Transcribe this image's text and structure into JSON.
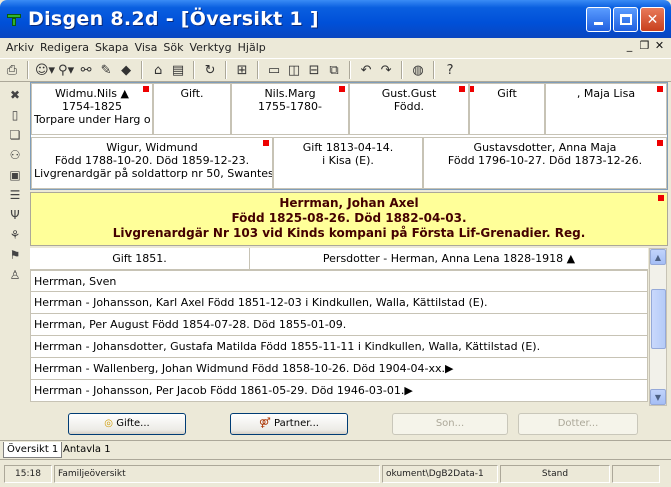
{
  "window": {
    "title": "Disgen 8.2d - [Översikt 1 ]"
  },
  "menu": [
    "Arkiv",
    "Redigera",
    "Skapa",
    "Visa",
    "Sök",
    "Verktyg",
    "Hjälp"
  ],
  "grandparents": [
    {
      "line1": "Widmu.Nils ▲",
      "line2": "1754-1825",
      "line3": "Torpare under Harg o"
    },
    {
      "line1": "Gift.",
      "line2": "",
      "line3": ""
    },
    {
      "line1": "Nils.Marg",
      "line2": "1755-1780-",
      "line3": ""
    },
    {
      "line1": "Gust.Gust",
      "line2": "Född.",
      "line3": ""
    },
    {
      "line1": "Gift",
      "line2": "",
      "line3": ""
    },
    {
      "line1": ", Maja Lisa",
      "line2": "",
      "line3": ""
    }
  ],
  "parents": {
    "father": {
      "line1": "Wigur, Widmund",
      "line2": "Född 1788-10-20. Död 1859-12-23.",
      "line3": "Livgrenardgär på soldattorp nr 50, Swantes"
    },
    "marriage": {
      "line1": "Gift 1813-04-14.",
      "line2": "i Kisa (E)."
    },
    "mother": {
      "line1": "Gustavsdotter, Anna Maja",
      "line2": "Född 1796-10-27. Död 1873-12-26."
    }
  },
  "main_person": {
    "name": "Herrman, Johan Axel",
    "dates": "Född 1825-08-26. Död 1882-04-03.",
    "occupation": "Livgrenardgär Nr 103 vid Kinds kompani på Första Lif-Grenadier. Reg."
  },
  "spouse": {
    "marriage": "Gift 1851.",
    "name": "Persdotter - Herman, Anna Lena 1828-1918 ▲"
  },
  "children": [
    "Herrman, Sven",
    "Herrman - Johansson, Karl Axel Född 1851-12-03 i Kindkullen, Walla, Kättilstad (E).",
    "Herrman, Per August Född 1854-07-28. Död 1855-01-09.",
    "Herrman - Johansdotter, Gustafa Matilda Född 1855-11-11 i Kindkullen, Walla, Kättilstad (E).",
    "Herrman - Wallenberg, Johan Widmund Född 1858-10-26. Död 1904-04-xx.▶",
    "Herrman - Johansson, Per Jacob Född 1861-05-29. Död 1946-03-01.▶"
  ],
  "buttons": {
    "gifte": "Gifte...",
    "partner": "Partner...",
    "son": "Son...",
    "dotter": "Dotter..."
  },
  "tabs": [
    "Översikt 1",
    "Antavla 1"
  ],
  "status": {
    "time": "15:18",
    "view": "Familjeöversikt",
    "path": "okument\\DgB2Data-1",
    "mode": "Stand"
  },
  "colors": {
    "main_person_bg": "#ffff99",
    "flag": "#e00000",
    "title_bar": "#0050d8"
  }
}
